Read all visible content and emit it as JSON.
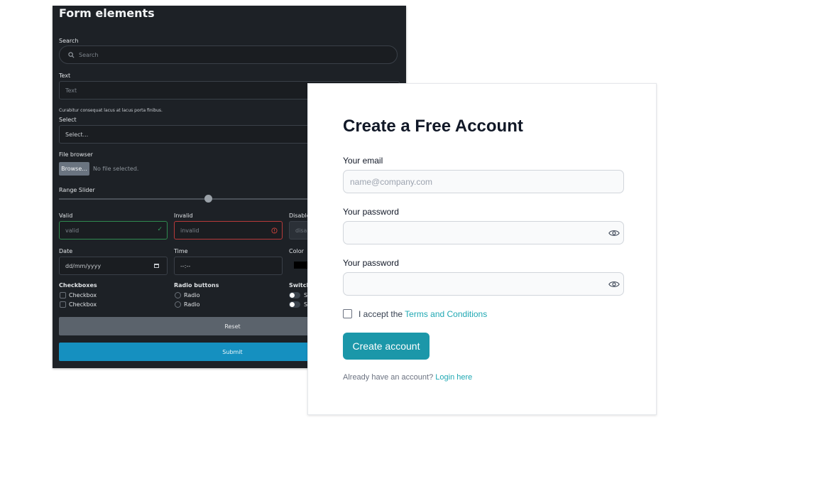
{
  "dark_form": {
    "title": "Form elements",
    "search": {
      "label": "Search",
      "placeholder": "Search"
    },
    "text": {
      "label": "Text",
      "placeholder": "Text",
      "help": "Curabitur consequat lacus at lacus porta finibus."
    },
    "select": {
      "label": "Select",
      "value": "Select..."
    },
    "file": {
      "label": "File browser",
      "button": "Browse...",
      "status": "No file selected."
    },
    "range": {
      "label": "Range Slider",
      "value_fraction": 0.5
    },
    "valid": {
      "label": "Valid",
      "value": "valid"
    },
    "invalid": {
      "label": "Invalid",
      "value": "invalid"
    },
    "disabled": {
      "label": "Disable",
      "value": "disa"
    },
    "date": {
      "label": "Date",
      "value": "dd/mm/yyyy"
    },
    "time": {
      "label": "Time",
      "value": "--:--"
    },
    "color": {
      "label": "Color",
      "value": "#000000"
    },
    "checkboxes": {
      "label": "Checkboxes",
      "items": [
        "Checkbox",
        "Checkbox"
      ]
    },
    "radios": {
      "label": "Radio buttons",
      "items": [
        "Radio",
        "Radio"
      ]
    },
    "switches": {
      "label": "Switch",
      "items": [
        "S",
        "S"
      ]
    },
    "reset_label": "Reset",
    "submit_label": "Submit",
    "colors": {
      "background": "#1d2126",
      "submit": "#1590c0",
      "reset": "#5b636c"
    }
  },
  "signup": {
    "heading": "Create a Free Account",
    "email": {
      "label": "Your email",
      "placeholder": "name@company.com"
    },
    "password": {
      "label": "Your password",
      "placeholder": ""
    },
    "confirm_password": {
      "label": "Your password",
      "placeholder": ""
    },
    "terms": {
      "prefix": "I accept the ",
      "link": "Terms and Conditions"
    },
    "submit_label": "Create account",
    "login": {
      "prefix": "Already have an account? ",
      "link": "Login here"
    },
    "colors": {
      "accent": "#1b97a9",
      "link": "#20a8b3"
    }
  }
}
